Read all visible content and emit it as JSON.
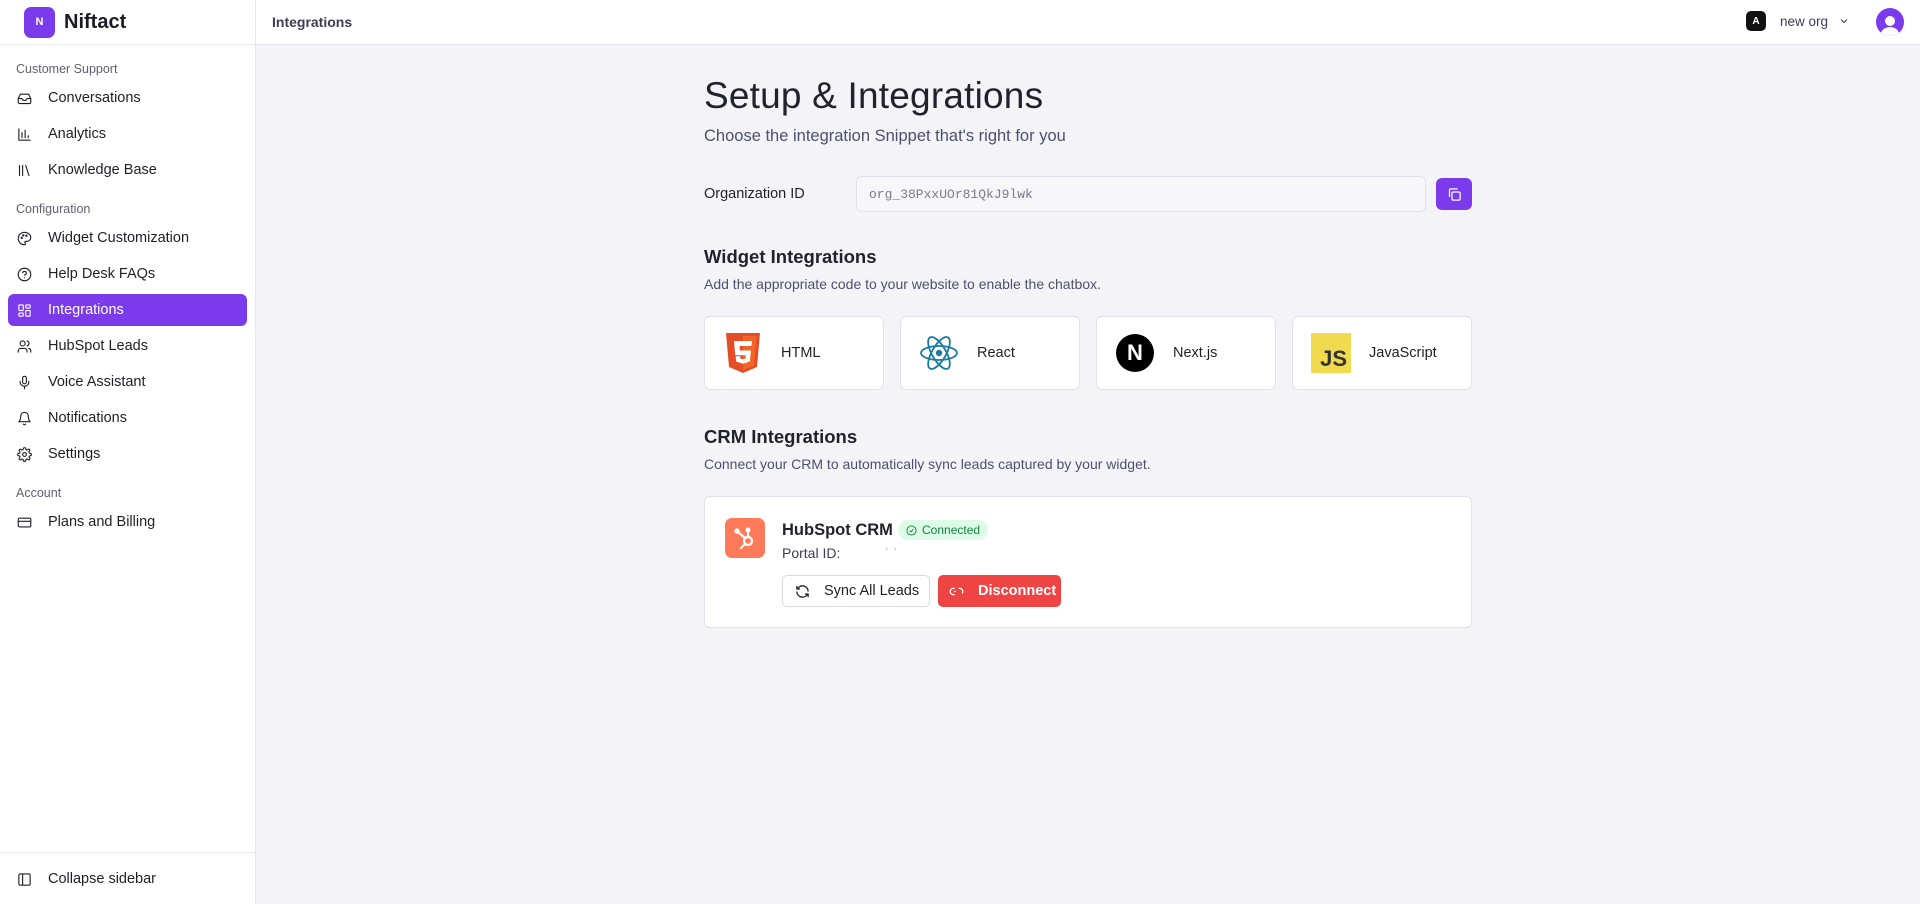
{
  "app": {
    "name": "Niftact",
    "logo_text": "N"
  },
  "header": {
    "title": "Integrations",
    "org_name": "new org",
    "org_initial": "A"
  },
  "colors": {
    "accent": "#7c3aed",
    "danger": "#ef4444",
    "success_bg": "#dcfce7",
    "success_text": "#15803d",
    "hubspot": "#ff7a59"
  },
  "sidebar": {
    "sections": [
      {
        "title": "Customer Support",
        "items": [
          {
            "label": "Conversations",
            "icon": "inbox-icon"
          },
          {
            "label": "Analytics",
            "icon": "bar-chart-icon"
          },
          {
            "label": "Knowledge Base",
            "icon": "library-icon"
          }
        ]
      },
      {
        "title": "Configuration",
        "items": [
          {
            "label": "Widget Customization",
            "icon": "palette-icon"
          },
          {
            "label": "Help Desk FAQs",
            "icon": "help-circle-icon"
          },
          {
            "label": "Integrations",
            "icon": "grid-icon",
            "active": true
          },
          {
            "label": "HubSpot Leads",
            "icon": "users-icon"
          },
          {
            "label": "Voice Assistant",
            "icon": "mic-icon"
          },
          {
            "label": "Notifications",
            "icon": "bell-icon"
          },
          {
            "label": "Settings",
            "icon": "gear-icon"
          }
        ]
      },
      {
        "title": "Account",
        "items": [
          {
            "label": "Plans and Billing",
            "icon": "credit-card-icon"
          }
        ]
      }
    ],
    "collapse_label": "Collapse sidebar"
  },
  "main": {
    "title": "Setup & Integrations",
    "subtitle": "Choose the integration Snippet that's right for you",
    "org_id_label": "Organization ID",
    "org_id_value": "org_38PxxUOr81QkJ9lwk",
    "widgets": {
      "title": "Widget Integrations",
      "description": "Add the appropriate code to your website to enable the chatbox.",
      "items": [
        {
          "label": "HTML",
          "icon": "html5-icon"
        },
        {
          "label": "React",
          "icon": "react-icon"
        },
        {
          "label": "Next.js",
          "icon": "nextjs-icon",
          "icon_text": "N"
        },
        {
          "label": "JavaScript",
          "icon": "javascript-icon",
          "icon_text": "JS"
        }
      ]
    },
    "crm": {
      "title": "CRM Integrations",
      "description": "Connect your CRM to automatically sync leads captured by your widget.",
      "name": "HubSpot CRM",
      "status": "Connected",
      "portal_label": "Portal ID:",
      "portal_value": "ʾ  ʾ",
      "sync_label": "Sync All Leads",
      "disconnect_label": "Disconnect"
    }
  }
}
